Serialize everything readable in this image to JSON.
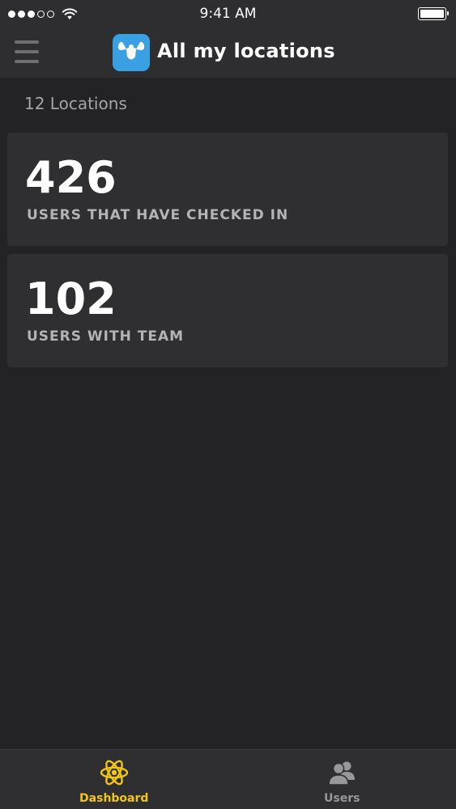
{
  "status_bar": {
    "time": "9:41 AM"
  },
  "header": {
    "title": "All my locations",
    "logo_icon": "flexing-arms-icon",
    "menu_icon": "hamburger-menu-icon"
  },
  "summary": {
    "locations_count": "12 Locations"
  },
  "stats": [
    {
      "value": "426",
      "label": "USERS THAT HAVE CHECKED IN"
    },
    {
      "value": "102",
      "label": "USERS WITH TEAM"
    }
  ],
  "tabs": [
    {
      "label": "Dashboard",
      "icon": "atom-icon",
      "active": true
    },
    {
      "label": "Users",
      "icon": "users-icon",
      "active": false
    }
  ],
  "colors": {
    "background": "#232224",
    "bar": "#2e2d30",
    "card": "#2f2e31",
    "accent": "#f3c614",
    "logo": "#3aa0e3"
  }
}
